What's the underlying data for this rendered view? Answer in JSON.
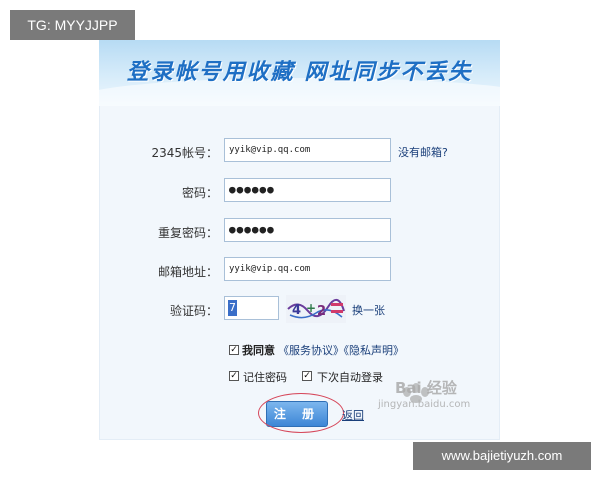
{
  "overlay": {
    "tag": "TG: MYYJJPP",
    "footer_url": "www.bajietiyuzh.com"
  },
  "banner": {
    "title": "登录帐号用收藏  网址同步不丢失"
  },
  "form": {
    "account": {
      "label": "2345帐号：",
      "value": "yyik@vip.qq.com",
      "link": "没有邮箱?"
    },
    "password": {
      "label": "密码：",
      "value": "●●●●●●"
    },
    "confirm_password": {
      "label": "重复密码：",
      "value": "●●●●●●"
    },
    "email": {
      "label": "邮箱地址：",
      "value": "yyik@vip.qq.com"
    },
    "captcha": {
      "label": "验证码：",
      "value": "7",
      "refresh_label": "换一张"
    },
    "agree": {
      "checked": true,
      "text": "我同意",
      "terms_link": "《服务协议》",
      "privacy_link": "《隐私声明》"
    },
    "remember_password": {
      "checked": true,
      "label": "记住密码"
    },
    "auto_login": {
      "checked": true,
      "label": "下次自动登录"
    },
    "register_label": "注 册",
    "return_label": "返回"
  },
  "watermark": {
    "brand": "Bai  经验",
    "sub": "jingyan.baidu.com"
  },
  "colors": {
    "accent": "#3d86d6",
    "highlight_circle": "#d6475a"
  }
}
